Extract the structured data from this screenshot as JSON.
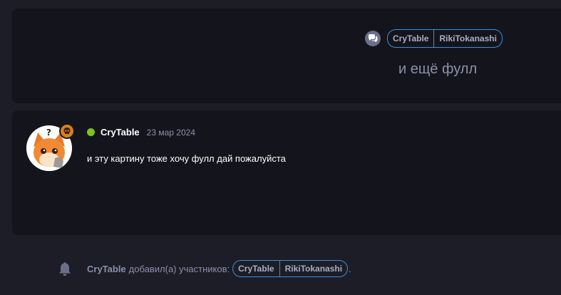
{
  "top_card": {
    "participants": [
      "CryTable",
      "RikiTokanashi"
    ],
    "message": "и ещё фулл"
  },
  "message": {
    "author": "CryTable",
    "date": "23 мар 2024",
    "text": "и эту картину тоже хочу фулл дай пожалуйста",
    "status_color": "#7cc41a"
  },
  "notice": {
    "author": "CryTable",
    "action": "добавил(а) участников:",
    "participants": [
      "CryTable",
      "RikiTokanashi"
    ],
    "end": "."
  },
  "colors": {
    "background": "#1c1d26",
    "card": "#14151c",
    "accent_border": "#3b8fd9",
    "muted_text": "#8c90aa",
    "badge": "#d9801d"
  },
  "icons": {
    "chat": "chat-bubbles-icon",
    "bell": "bell-icon",
    "badge": "skull-icon"
  }
}
